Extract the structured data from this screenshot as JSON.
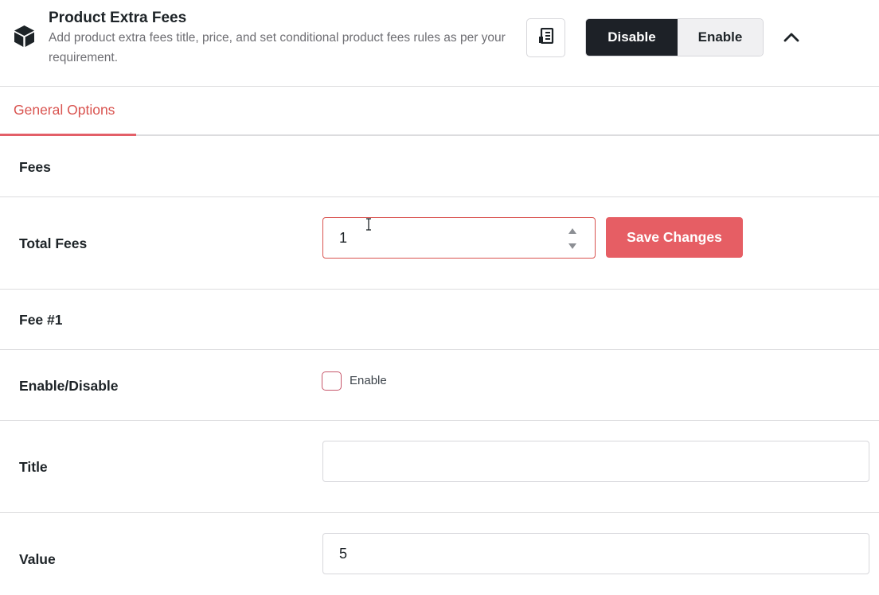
{
  "header": {
    "title": "Product Extra Fees",
    "description": "Add product extra fees title, price, and set conditional product fees rules as per your requirement.",
    "module_icon": "cube-icon",
    "doc_icon": "document-icon",
    "toggle": {
      "disable_label": "Disable",
      "enable_label": "Enable",
      "active": "Disable"
    },
    "collapse_icon": "chevron-up-icon"
  },
  "tabs": [
    {
      "label": "General Options",
      "active": true
    }
  ],
  "sections": {
    "fees_heading": "Fees",
    "total_fees": {
      "label": "Total Fees",
      "value": "1"
    },
    "save_label": "Save Changes",
    "fee_heading": "Fee #1",
    "enable_disable": {
      "label": "Enable/Disable",
      "checkbox_label": "Enable",
      "checked": false
    },
    "title": {
      "label": "Title",
      "value": ""
    },
    "value": {
      "label": "Value",
      "value": "5"
    }
  },
  "colors": {
    "accent": "#e65e64",
    "dark_toggle": "#1d2127",
    "tab_active_text": "#d9534f"
  }
}
